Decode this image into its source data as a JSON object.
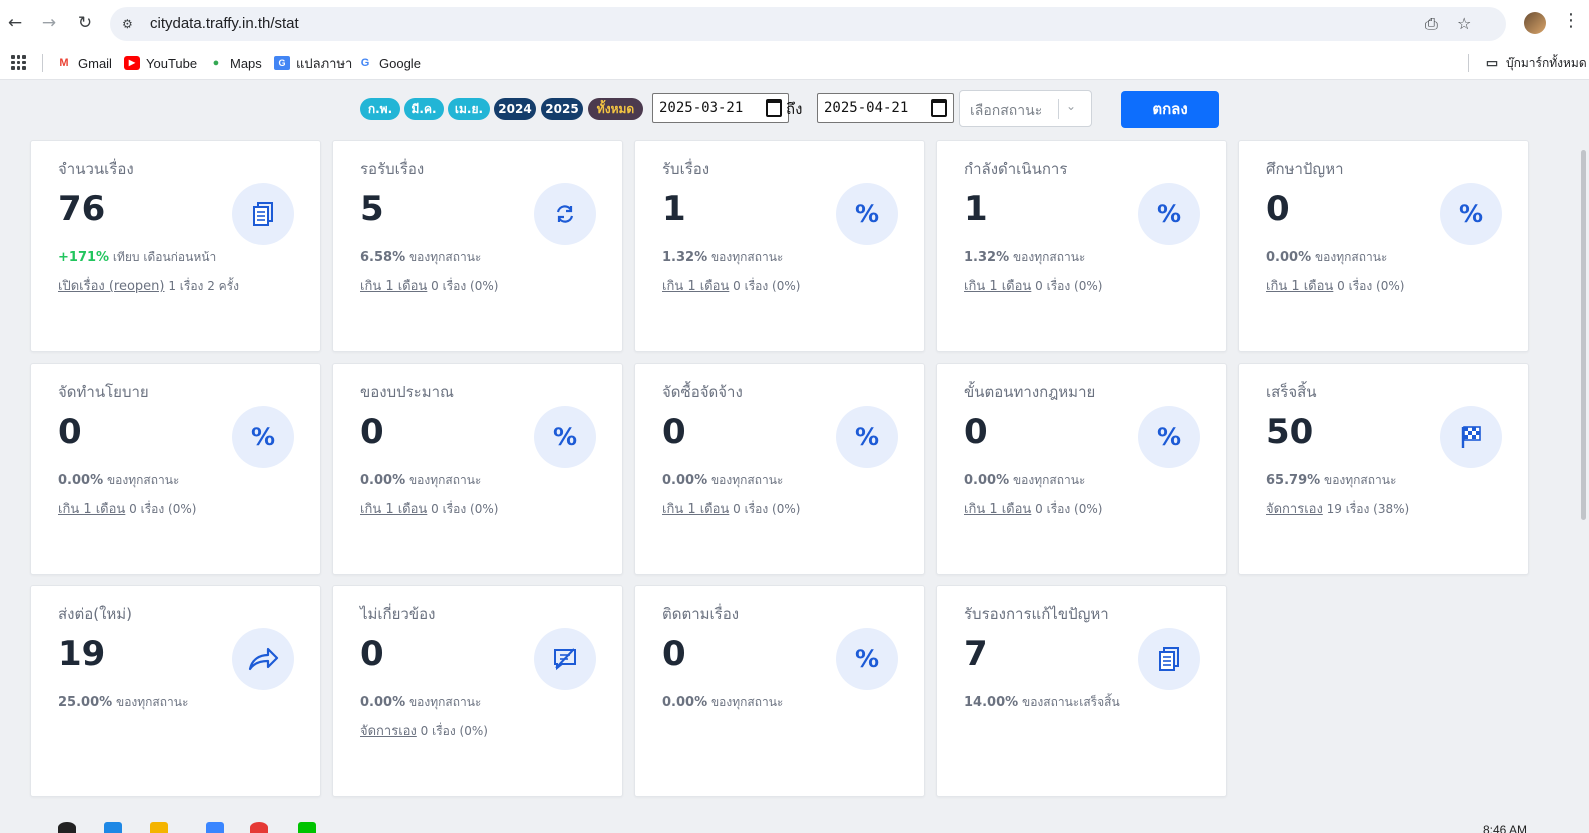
{
  "browser": {
    "url": "citydata.traffy.in.th/stat",
    "bookmarks": [
      "Gmail",
      "YouTube",
      "Maps",
      "แปลภาษา",
      "Google"
    ],
    "all_bookmarks": "บุ๊กมาร์กทั้งหมด"
  },
  "filters": {
    "pills": [
      "ก.พ.",
      "มี.ค.",
      "เม.ย.",
      "2024",
      "2025",
      "ทั้งหมด"
    ],
    "date_from": "2025-03-21",
    "to_label": "ถึง",
    "date_to": "2025-04-21",
    "status_placeholder": "เลือกสถานะ",
    "submit": "ตกลง"
  },
  "cards": [
    {
      "title": "จำนวนเรื่อง",
      "value": "76",
      "icon": "documents-icon",
      "pct": "+171%",
      "pct_text": "เทียบ เดือนก่อนหน้า",
      "link": "เปิดเรื่อง (reopen)",
      "link_text": "1 เรื่อง 2 ครั้ง"
    },
    {
      "title": "รอรับเรื่อง",
      "value": "5",
      "icon": "refresh-icon",
      "pct": "6.58%",
      "pct_text": "ของทุกสถานะ",
      "link": "เกิน 1 เดือน",
      "link_text": "0 เรื่อง (0%)"
    },
    {
      "title": "รับเรื่อง",
      "value": "1",
      "icon": "percent-icon",
      "pct": "1.32%",
      "pct_text": "ของทุกสถานะ",
      "link": "เกิน 1 เดือน",
      "link_text": "0 เรื่อง (0%)"
    },
    {
      "title": "กำลังดำเนินการ",
      "value": "1",
      "icon": "percent-icon",
      "pct": "1.32%",
      "pct_text": "ของทุกสถานะ",
      "link": "เกิน 1 เดือน",
      "link_text": "0 เรื่อง (0%)"
    },
    {
      "title": "ศึกษาปัญหา",
      "value": "0",
      "icon": "percent-icon",
      "pct": "0.00%",
      "pct_text": "ของทุกสถานะ",
      "link": "เกิน 1 เดือน",
      "link_text": "0 เรื่อง (0%)"
    },
    {
      "title": "จัดทำนโยบาย",
      "value": "0",
      "icon": "percent-icon",
      "pct": "0.00%",
      "pct_text": "ของทุกสถานะ",
      "link": "เกิน 1 เดือน",
      "link_text": "0 เรื่อง (0%)"
    },
    {
      "title": "ของบประมาณ",
      "value": "0",
      "icon": "percent-icon",
      "pct": "0.00%",
      "pct_text": "ของทุกสถานะ",
      "link": "เกิน 1 เดือน",
      "link_text": "0 เรื่อง (0%)"
    },
    {
      "title": "จัดซื้อจัดจ้าง",
      "value": "0",
      "icon": "percent-icon",
      "pct": "0.00%",
      "pct_text": "ของทุกสถานะ",
      "link": "เกิน 1 เดือน",
      "link_text": "0 เรื่อง (0%)"
    },
    {
      "title": "ขั้นตอนทางกฎหมาย",
      "value": "0",
      "icon": "percent-icon",
      "pct": "0.00%",
      "pct_text": "ของทุกสถานะ",
      "link": "เกิน 1 เดือน",
      "link_text": "0 เรื่อง (0%)"
    },
    {
      "title": "เสร็จสิ้น",
      "value": "50",
      "icon": "checkered-flag-icon",
      "pct": "65.79%",
      "pct_text": "ของทุกสถานะ",
      "link": "จัดการเอง",
      "link_text": "19 เรื่อง (38%)"
    },
    {
      "title": "ส่งต่อ(ใหม่)",
      "value": "19",
      "icon": "forward-arrow-icon",
      "pct": "25.00%",
      "pct_text": "ของทุกสถานะ",
      "link": "",
      "link_text": ""
    },
    {
      "title": "ไม่เกี่ยวข้อง",
      "value": "0",
      "icon": "no-comment-icon",
      "pct": "0.00%",
      "pct_text": "ของทุกสถานะ",
      "link": "จัดการเอง",
      "link_text": "0 เรื่อง (0%)"
    },
    {
      "title": "ติดตามเรื่อง",
      "value": "0",
      "icon": "percent-icon",
      "pct": "0.00%",
      "pct_text": "ของทุกสถานะ",
      "link": "",
      "link_text": ""
    },
    {
      "title": "รับรองการแก้ไขปัญหา",
      "value": "7",
      "icon": "documents-icon",
      "pct": "14.00%",
      "pct_text": "ของสถานะเสร็จสิ้น",
      "link": "",
      "link_text": ""
    }
  ],
  "taskbar": {
    "clock": "8:46 AM"
  }
}
